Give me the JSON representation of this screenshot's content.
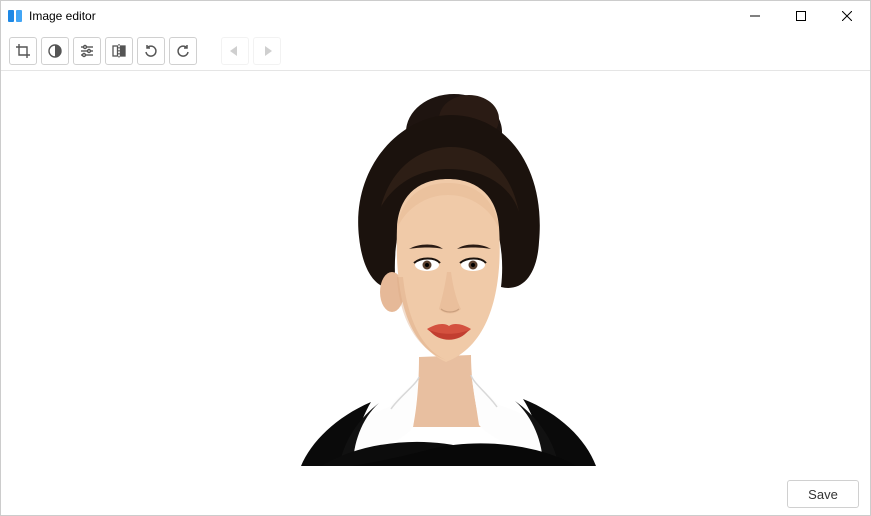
{
  "window": {
    "title": "Image editor"
  },
  "toolbar": {
    "crop": "crop",
    "contrast": "contrast",
    "adjust": "adjust",
    "flip": "flip",
    "rotate_left": "rotate-left",
    "rotate_right": "rotate-right",
    "undo": "undo",
    "redo": "redo"
  },
  "footer": {
    "save_label": "Save"
  },
  "image": {
    "description": "portrait-photo"
  }
}
